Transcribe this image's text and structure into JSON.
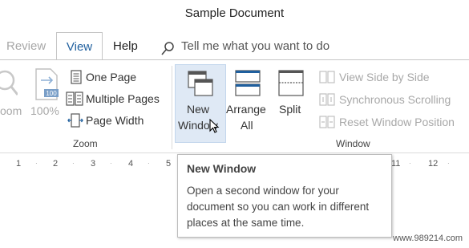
{
  "window": {
    "title": "Sample Document"
  },
  "tabs": [
    {
      "label": "Review",
      "state": "faded"
    },
    {
      "label": "View",
      "state": "active"
    },
    {
      "label": "Help",
      "state": "normal"
    }
  ],
  "tell_me": {
    "placeholder": "Tell me what you want to do",
    "icon": "lightbulb-icon"
  },
  "zoom_group": {
    "label": "Zoom",
    "zoom_button": {
      "label": "oom",
      "icon": "magnifier-icon"
    },
    "hundred_button": {
      "label": "100%",
      "badge": "100",
      "icon": "page-100-icon"
    },
    "one_page": {
      "label": "One Page",
      "icon": "one-page-icon"
    },
    "multiple_pages": {
      "label": "Multiple Pages",
      "icon": "multiple-pages-icon"
    },
    "page_width": {
      "label": "Page Width",
      "icon": "page-width-icon"
    }
  },
  "window_group": {
    "label": "Window",
    "new_window": {
      "line1": "New",
      "line2": "Window",
      "icon": "new-window-icon"
    },
    "arrange_all": {
      "line1": "Arrange",
      "line2": "All",
      "icon": "arrange-all-icon"
    },
    "split": {
      "label": "Split",
      "icon": "split-icon"
    },
    "view_side_by_side": {
      "label": "View Side by Side",
      "icon": "side-by-side-icon"
    },
    "synchronous_scrolling": {
      "label": "Synchronous Scrolling",
      "icon": "sync-scroll-icon"
    },
    "reset_window_position": {
      "label": "Reset Window Position",
      "icon": "reset-position-icon"
    }
  },
  "ruler": {
    "left_ticks": [
      "1",
      "2",
      "3",
      "4",
      "5"
    ],
    "right_ticks": [
      "11",
      "12"
    ]
  },
  "tooltip": {
    "title": "New Window",
    "body": "Open a second window for your document so you can work in different places at the same time."
  },
  "watermark": "www.989214.com",
  "colors": {
    "accent": "#1f5f9e",
    "highlight": "#dfe9f5",
    "disabled": "#a8a8a8"
  }
}
